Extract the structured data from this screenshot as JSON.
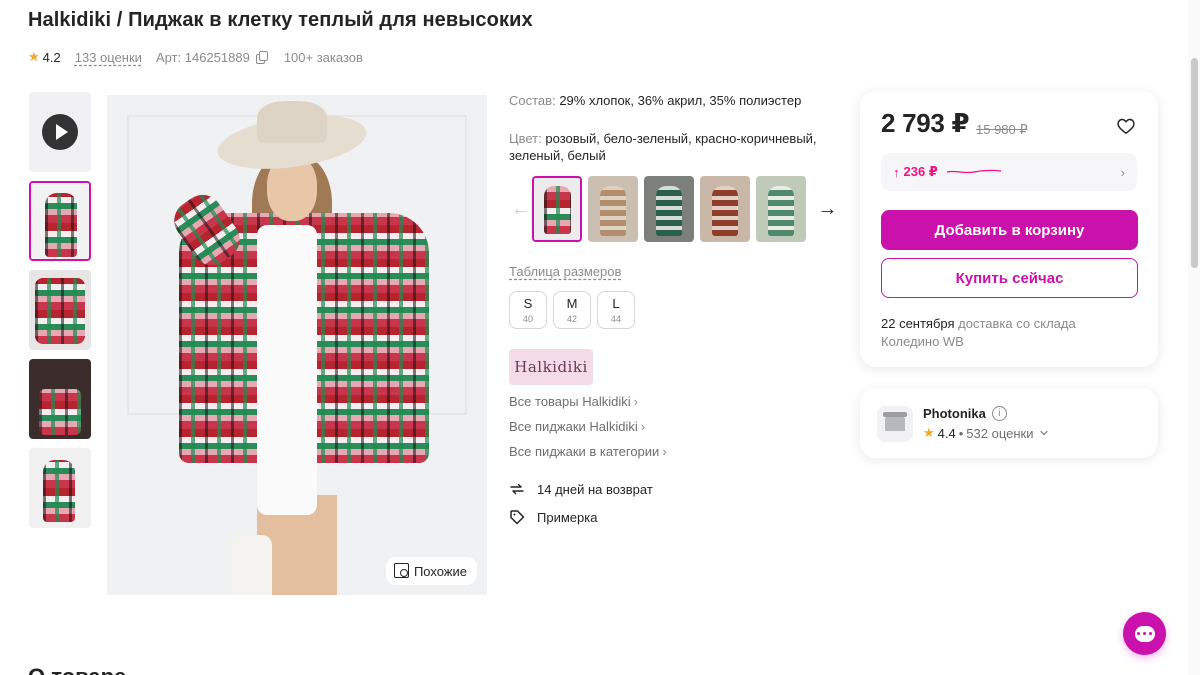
{
  "product": {
    "title": "Halkidiki / Пиджак в клетку теплый для невысоких",
    "rating": "4.2",
    "reviews": "133 оценки",
    "article": "Арт: 146251889",
    "orders": "100+ заказов"
  },
  "gallery": {
    "similar_label": "Похожие"
  },
  "details": {
    "composition_label": "Состав:",
    "composition_value": "29% хлопок, 36% акрил, 35% полиэстер",
    "color_label": "Цвет:",
    "color_value": "розовый, бело-зеленый, красно-коричневый, зеленый, белый",
    "size_table_label": "Таблица размеров",
    "sizes": [
      {
        "size": "S",
        "ru": "40"
      },
      {
        "size": "M",
        "ru": "42"
      },
      {
        "size": "L",
        "ru": "44"
      }
    ],
    "brand": "Halkidiki",
    "links": [
      "Все товары Halkidiki",
      "Все пиджаки Halkidiki",
      "Все пиджаки в категории"
    ],
    "features": [
      {
        "icon": "return-arrows-icon",
        "label": "14 дней на возврат"
      },
      {
        "icon": "tag-icon",
        "label": "Примерка"
      }
    ]
  },
  "purchase": {
    "price": "2 793 ₽",
    "old_price": "15 980 ₽",
    "discount": "236 ₽",
    "add_to_cart": "Добавить в корзину",
    "buy_now": "Купить сейчас",
    "delivery_date": "22 сентября",
    "delivery_rest": "доставка со склада Коледино WB"
  },
  "seller": {
    "name": "Photonika",
    "rating": "4.4",
    "reviews": "532 оценки"
  },
  "page": {
    "bottom_heading": "О товаре"
  },
  "colors": {
    "accent": "#cb11ab",
    "discount": "#f1117e",
    "star": "#f5a623"
  }
}
